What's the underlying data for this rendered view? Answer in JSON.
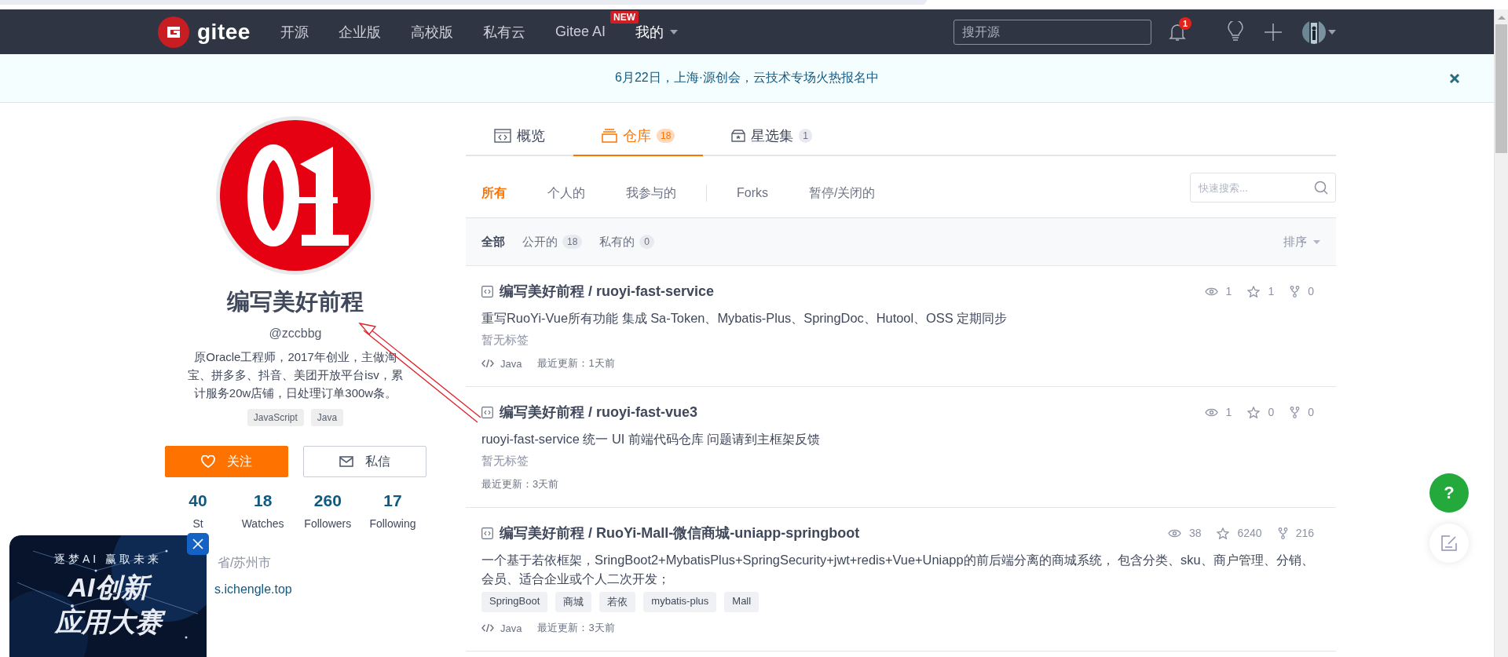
{
  "navbar": {
    "brand": "gitee",
    "links": [
      {
        "label": "开源"
      },
      {
        "label": "企业版"
      },
      {
        "label": "高校版"
      },
      {
        "label": "私有云"
      },
      {
        "label": "Gitee AI",
        "badge": "NEW"
      },
      {
        "label": "我的",
        "kind": "dropdown"
      }
    ],
    "search": {
      "placeholder": "搜开源"
    },
    "notification_count": "1"
  },
  "banner": {
    "text": "6月22日，上海·源创会，云技术专场火热报名中"
  },
  "profile": {
    "name": "编写美好前程",
    "handle": "@zccbbg",
    "bio": "原Oracle工程师，2017年创业，主做淘宝、拼多多、抖音、美团开放平台isv，累计服务20w店铺，日处理订单300w条。",
    "tags": [
      "JavaScript",
      "Java"
    ],
    "follow_button": "关注",
    "message_button": "私信",
    "stats": [
      {
        "value": "40",
        "label": "St"
      },
      {
        "value": "18",
        "label": "Watches"
      },
      {
        "value": "260",
        "label": "Followers"
      },
      {
        "value": "17",
        "label": "Following"
      }
    ],
    "location": "省/苏州市",
    "website": "s.ichengle.top"
  },
  "tabs": [
    {
      "label": "概览",
      "kind": "overview",
      "selected": false
    },
    {
      "label": "仓库",
      "kind": "repos",
      "count": "18",
      "selected": true
    },
    {
      "label": "星选集",
      "kind": "collections",
      "count": "1",
      "selected": false
    }
  ],
  "filters": [
    {
      "label": "所有",
      "selected": true
    },
    {
      "label": "个人的",
      "selected": false
    },
    {
      "label": "我参与的",
      "selected": false
    },
    {
      "label": "Forks",
      "selected": false,
      "separated": true
    },
    {
      "label": "暂停/关闭的",
      "selected": false
    }
  ],
  "quick_search": {
    "placeholder": "快速搜索..."
  },
  "visibility": [
    {
      "label": "全部",
      "selected": true
    },
    {
      "label": "公开的",
      "count": "18",
      "selected": false
    },
    {
      "label": "私有的",
      "count": "0",
      "selected": false
    }
  ],
  "sort": "排序",
  "repos": [
    {
      "title": "编写美好前程 / ruoyi-fast-service",
      "description": "重写RuoYi-Vue所有功能 集成 Sa-Token、Mybatis-Plus、SpringDoc、Hutool、OSS 定期同步",
      "tags_placeholder": "暂无标签",
      "language": "Java",
      "updated": "最近更新：1天前",
      "views": "1",
      "star_count": "1",
      "forks": "0"
    },
    {
      "title": "编写美好前程 / ruoyi-fast-vue3",
      "description": "ruoyi-fast-service 统一 UI 前端代码仓库 问题请到主框架反馈",
      "tags_placeholder": "暂无标签",
      "updated": "最近更新：3天前",
      "views": "1",
      "star_count": "0",
      "forks": "0"
    },
    {
      "title": "编写美好前程 / RuoYi-Mall-微信商城-uniapp-springboot",
      "description": "一个基于若依框架，SringBoot2+MybatisPlus+SpringSecurity+jwt+redis+Vue+Uniapp的前后端分离的商城系统， 包含分类、sku、商户管理、分销、会员、适合企业或个人二次开发；",
      "tags": [
        "SpringBoot",
        "商城",
        "若依",
        "mybatis-plus",
        "Mall"
      ],
      "language": "Java",
      "updated": "最近更新：3天前",
      "views": "38",
      "star_count": "6240",
      "forks": "216"
    }
  ],
  "ad": {
    "tagline": "逐梦AI 赢取未来",
    "headline": "AI创新",
    "subline": "应用大赛"
  },
  "help_button": "?"
}
